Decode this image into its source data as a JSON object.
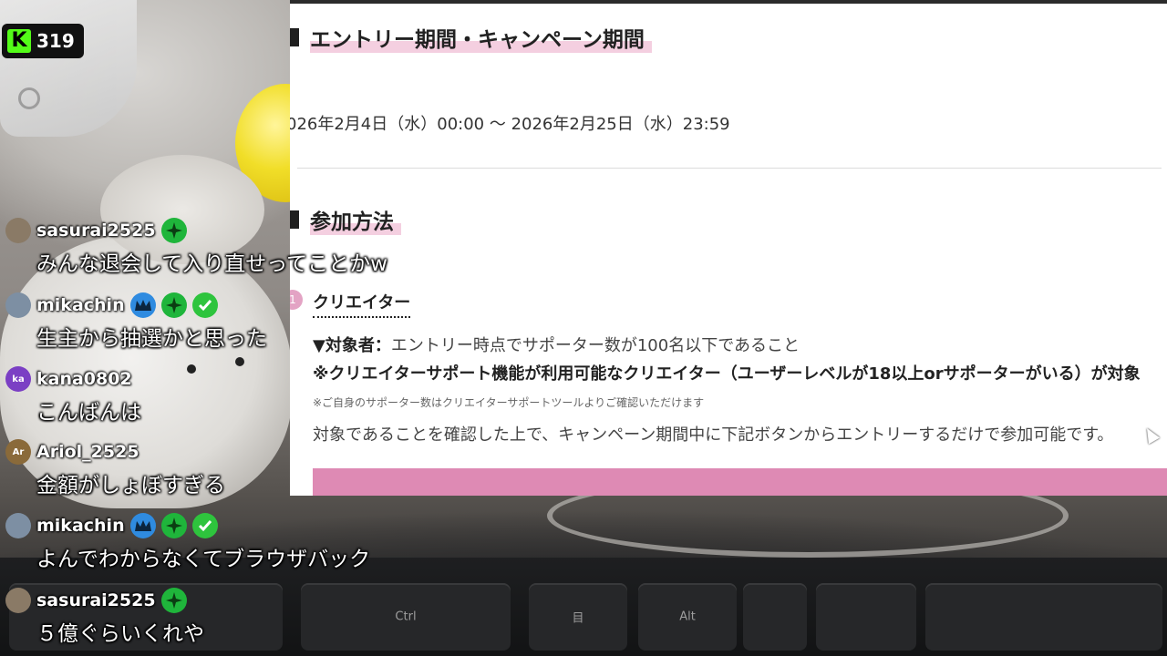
{
  "viewer_badge": {
    "count": "319",
    "logo": "K"
  },
  "document": {
    "heading_period": "エントリー期間・キャンペーン期間",
    "period_text": "026年2月4日（水）00:00 〜 2026年2月25日（水）23:59",
    "heading_method": "参加方法",
    "step_number": "1",
    "creator_label": "クリエイター",
    "target_label": "▼対象者：",
    "target_text": "エントリー時点でサポーター数が100名以下であること",
    "bold_condition": "※クリエイターサポート機能が利用可能なクリエイター（ユーザーレベルが18以上orサポーターがいる）が対象",
    "small_note": "※ご自身のサポーター数はクリエイターサポートツールよりご確認いただけます",
    "description": "対象であることを確認した上で、キャンペーン期間中に下記ボタンからエントリーするだけで参加可能です。"
  },
  "chat": [
    {
      "username": "sasurai2525",
      "avatar": "",
      "avatar_color": "#8a7a66",
      "badges": [
        "star"
      ],
      "message": "みんな退会して入り直せってことかw"
    },
    {
      "username": "mikachin",
      "avatar": "",
      "avatar_color": "#7d8fa3",
      "badges": [
        "crown",
        "star",
        "check"
      ],
      "message": "生主から抽選かと思った"
    },
    {
      "username": "kana0802",
      "avatar": "ka",
      "avatar_color": "#7b3fc4",
      "badges": [],
      "message": "こんばんは"
    },
    {
      "username": "Ariol_2525",
      "avatar": "Ar",
      "avatar_color": "#8a6a3a",
      "badges": [],
      "message": "金額がしょぼすぎる"
    },
    {
      "username": "mikachin",
      "avatar": "",
      "avatar_color": "#7d8fa3",
      "badges": [
        "crown",
        "star",
        "check"
      ],
      "message": "よんでわからなくてブラウザバック"
    },
    {
      "username": "sasurai2525",
      "avatar": "",
      "avatar_color": "#8a7a66",
      "badges": [
        "star"
      ],
      "message": "５億ぐらいくれや"
    }
  ],
  "keyboard": {
    "keys": [
      "Ctrl",
      "目",
      "Alt",
      "",
      ""
    ]
  },
  "colors": {
    "kick_green": "#53fc18",
    "pink_bar": "#de8ab4",
    "heading_highlight": "#f4cfe0"
  }
}
